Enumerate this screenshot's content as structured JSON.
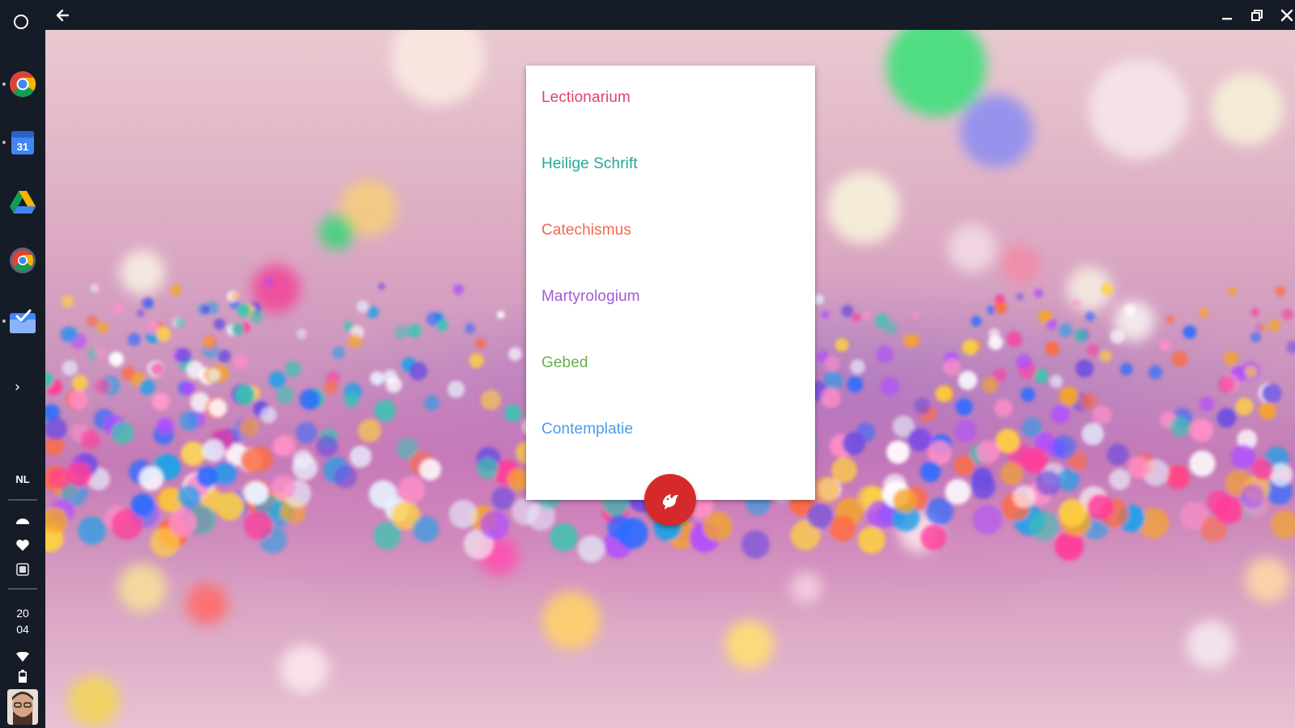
{
  "ime": {
    "label": "NL"
  },
  "clock": {
    "hour": "20",
    "minute": "04"
  },
  "shelf": {
    "apps": [
      {
        "icon": "chrome-icon"
      },
      {
        "icon": "calendar-icon",
        "text": "31"
      },
      {
        "icon": "drive-icon"
      },
      {
        "icon": "chrome-icon"
      },
      {
        "icon": "inbox-icon"
      }
    ]
  },
  "menu": {
    "items": [
      {
        "label": "Lectionarium",
        "color": "#e8416a"
      },
      {
        "label": "Heilige Schrift",
        "color": "#26a69a"
      },
      {
        "label": "Catechismus",
        "color": "#f4684c"
      },
      {
        "label": "Martyrologium",
        "color": "#a25bd4"
      },
      {
        "label": "Gebed",
        "color": "#6ab04c"
      },
      {
        "label": "Contemplatie",
        "color": "#4b9be8"
      }
    ]
  },
  "fab": {
    "color": "#d42a2a",
    "icon": "dove-icon"
  }
}
